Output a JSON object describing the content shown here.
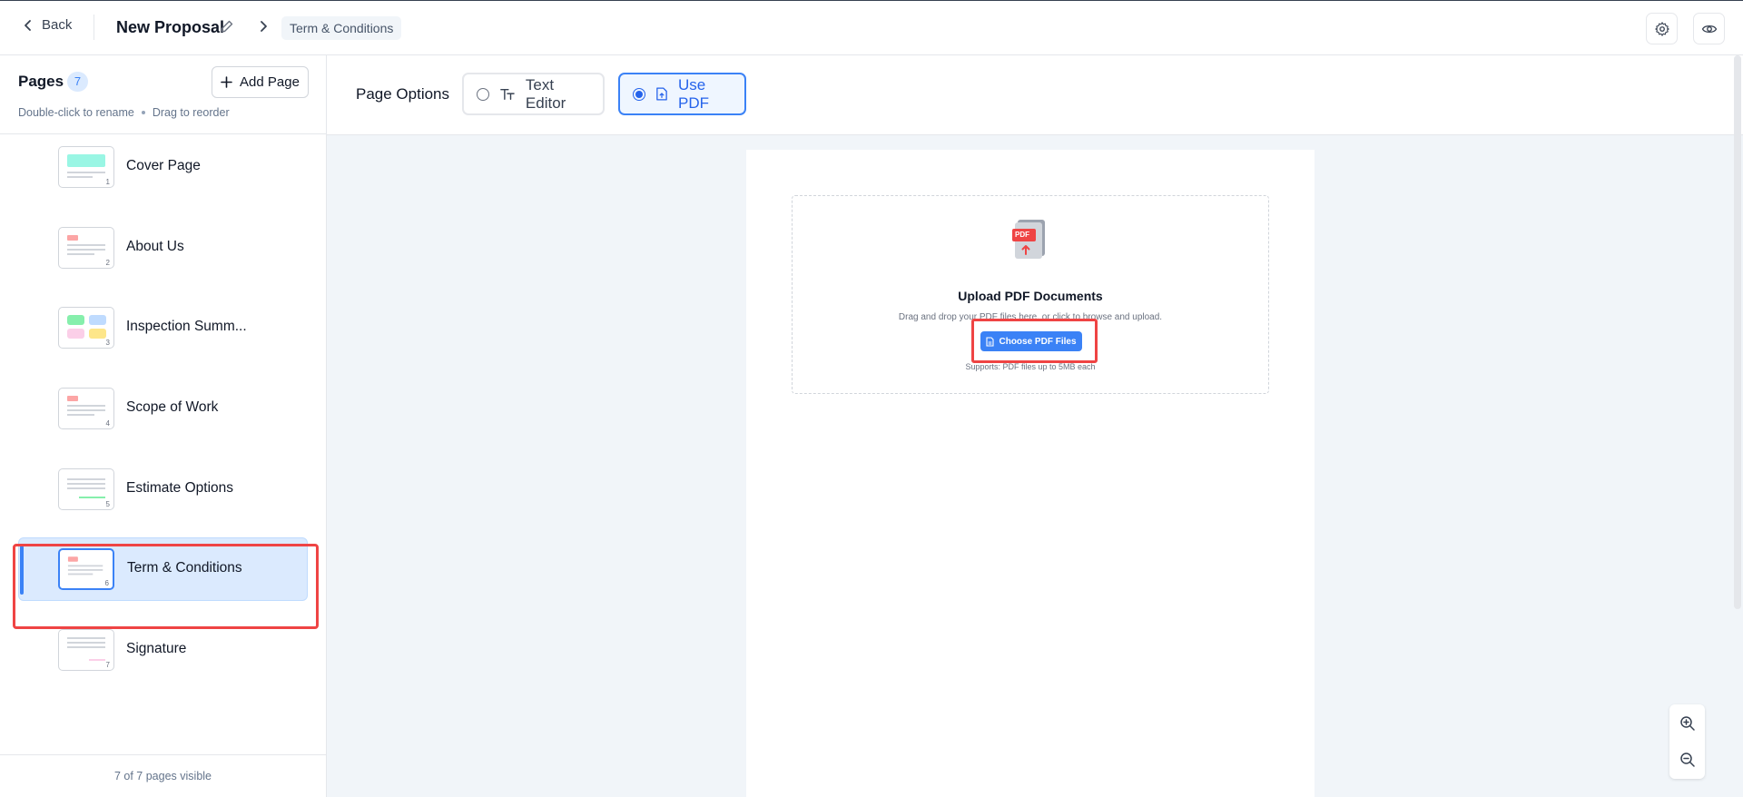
{
  "header": {
    "back_label": "Back",
    "title": "New Proposal",
    "breadcrumb_current": "Term & Conditions"
  },
  "sidebar": {
    "title": "Pages",
    "count": "7",
    "add_page_label": "Add Page",
    "hint_rename": "Double-click to rename",
    "hint_reorder": "Drag to reorder",
    "pages": [
      {
        "label": "Cover Page",
        "num": "1"
      },
      {
        "label": "About Us",
        "num": "2"
      },
      {
        "label": "Inspection Summ...",
        "num": "3"
      },
      {
        "label": "Scope of Work",
        "num": "4"
      },
      {
        "label": "Estimate Options",
        "num": "5"
      },
      {
        "label": "Term & Conditions",
        "num": "6"
      },
      {
        "label": "Signature",
        "num": "7"
      }
    ],
    "footer": "7 of 7 pages visible"
  },
  "page_options": {
    "label": "Page Options",
    "text_editor_label": "Text Editor",
    "use_pdf_label": "Use PDF",
    "selected": "Use PDF"
  },
  "upload": {
    "title": "Upload PDF Documents",
    "description": "Drag and drop your PDF files here, or click to browse and upload.",
    "button_label": "Choose PDF Files",
    "support_text": "Supports: PDF files up to 5MB each",
    "pdf_badge": "PDF"
  },
  "colors": {
    "accent": "#3b82f6",
    "highlight": "#ef4444",
    "active_bg": "#dbeafe"
  }
}
